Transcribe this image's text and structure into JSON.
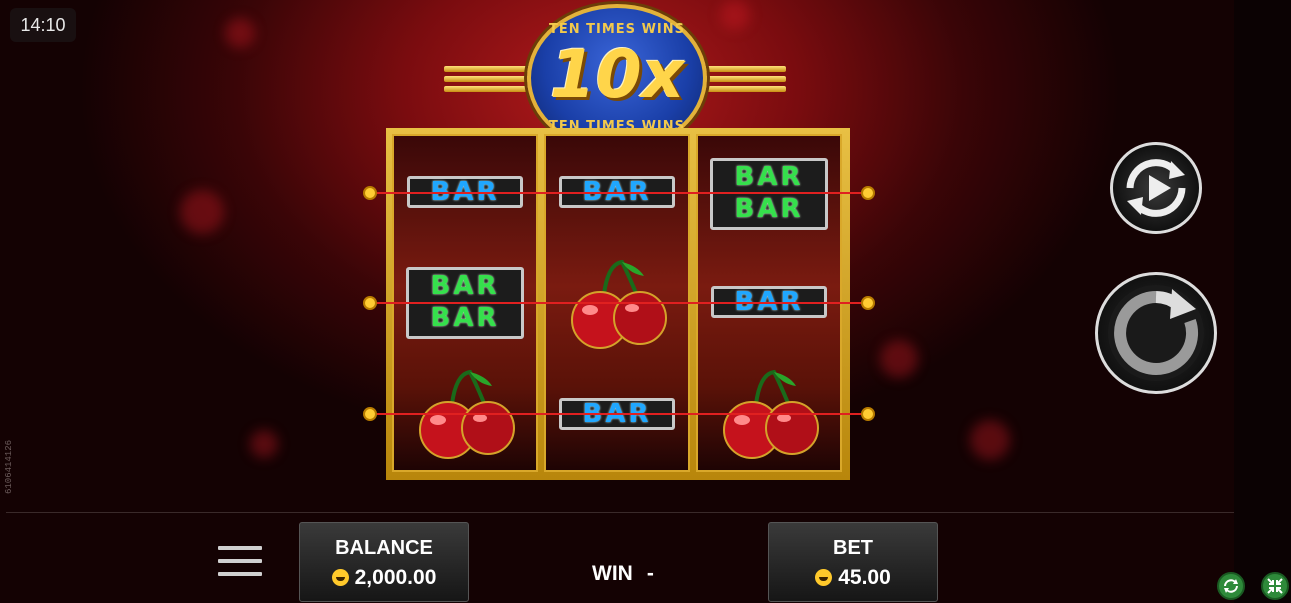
{
  "status": {
    "time": "14:10",
    "build_id": "6106414126"
  },
  "logo": {
    "text_top": "TEN TIMES WINS",
    "text_center": "10x",
    "text_bottom": "TEN TIMES WINS"
  },
  "reels": [
    {
      "symbols": [
        "single-bar",
        "double-bar",
        "cherry"
      ]
    },
    {
      "symbols": [
        "single-bar",
        "cherry",
        "single-bar"
      ]
    },
    {
      "symbols": [
        "double-bar",
        "single-bar",
        "cherry"
      ]
    }
  ],
  "symbol_text": {
    "bar": "BAR"
  },
  "colors": {
    "single_bar": "#1fa7ff",
    "double_bar": "#35e04c",
    "payline": "#e02020",
    "frame": "#d9a82a"
  },
  "controls": {
    "autoplay_icon": "autoplay-icon",
    "spin_icon": "spin-icon",
    "menu_icon": "menu-icon"
  },
  "balance": {
    "label": "BALANCE",
    "value": "2,000.00"
  },
  "win": {
    "label": "WIN",
    "value": "-"
  },
  "bet": {
    "label": "BET",
    "value": "45.00"
  }
}
